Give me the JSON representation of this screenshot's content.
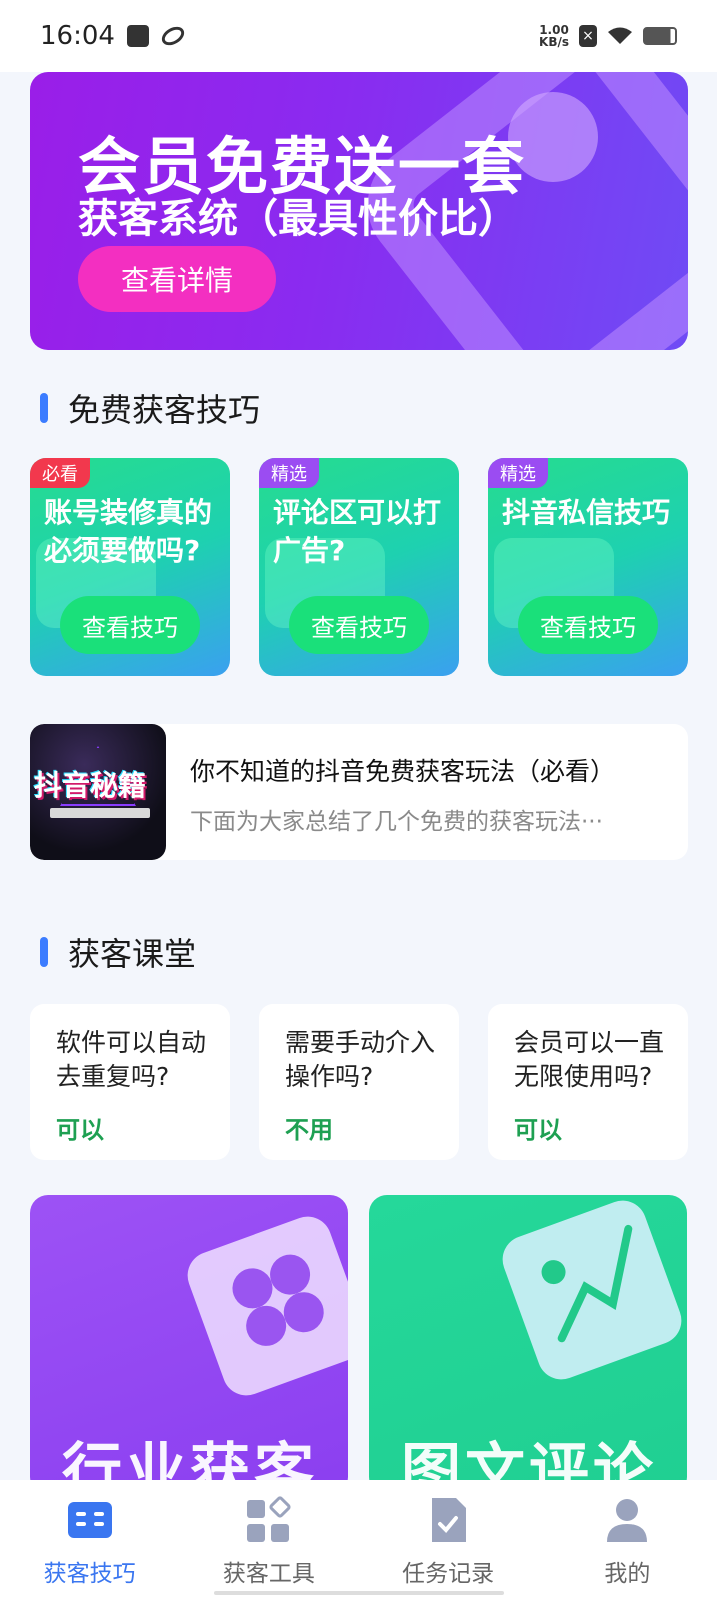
{
  "status_bar": {
    "time": "16:04",
    "net_speed_value": "1.00",
    "net_speed_unit": "KB/s"
  },
  "banner": {
    "title": "会员免费送一套",
    "subtitle": "获客系统（最具性价比）",
    "button_label": "查看详情"
  },
  "section_tips": {
    "title": "免费获客技巧",
    "cards": [
      {
        "tag": "必看",
        "title": "账号装修真的必须要做吗?",
        "button": "查看技巧"
      },
      {
        "tag": "精选",
        "title": "评论区可以打广告?",
        "button": "查看技巧"
      },
      {
        "tag": "精选",
        "title": "抖音私信技巧",
        "button": "查看技巧"
      }
    ]
  },
  "article": {
    "thumb_text": "抖音秘籍",
    "title": "你不知道的抖音免费获客玩法（必看）",
    "desc": "下面为大家总结了几个免费的获客玩法···"
  },
  "section_class": {
    "title": "获客课堂",
    "qa": [
      {
        "q": "软件可以自动去重复吗?",
        "a": "可以"
      },
      {
        "q": "需要手动介入操作吗?",
        "a": "不用"
      },
      {
        "q": "会员可以一直无限使用吗?",
        "a": "可以"
      }
    ]
  },
  "big_cards": [
    {
      "title": "行业获客"
    },
    {
      "title": "图文评论"
    }
  ],
  "bottom_nav": {
    "items": [
      {
        "label": "获客技巧"
      },
      {
        "label": "获客工具"
      },
      {
        "label": "任务记录"
      },
      {
        "label": "我的"
      }
    ]
  },
  "colors": {
    "accent": "#3a76f0",
    "banner_button": "#f32fc1",
    "tip_button": "#1ae07a",
    "answer_green": "#1ea052"
  }
}
